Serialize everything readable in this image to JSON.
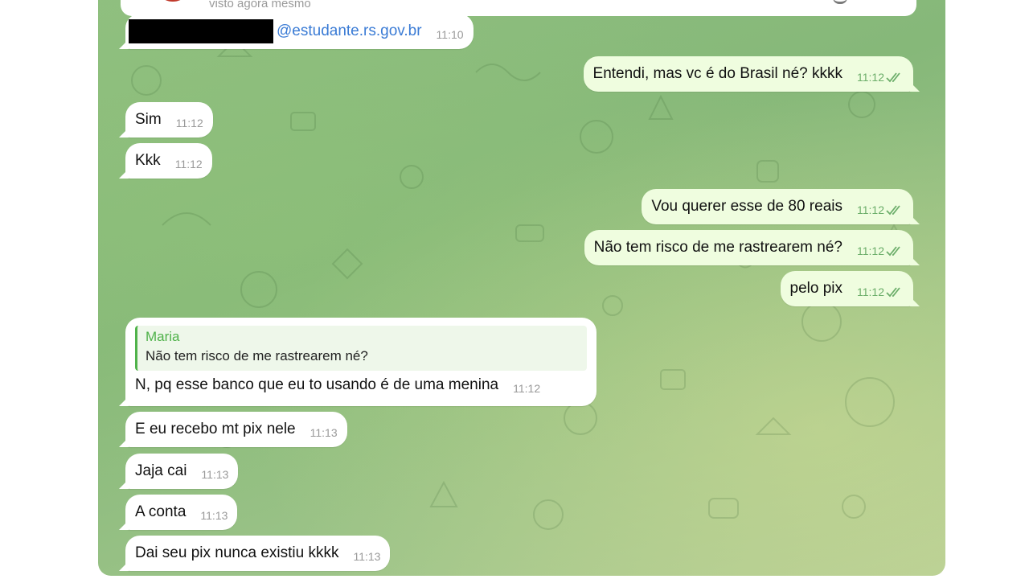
{
  "header": {
    "last_seen": "visto agora mesmo"
  },
  "messages": [
    {
      "side": "in",
      "email_domain": "@estudante.rs.gov.br",
      "time": "11:10",
      "email_redacted": true
    },
    {
      "side": "out",
      "text": "Entendi, mas vc é do Brasil né? kkkk",
      "time": "11:12",
      "read": true
    },
    {
      "side": "in",
      "text": "Sim",
      "time": "11:12"
    },
    {
      "side": "in",
      "text": "Kkk",
      "time": "11:12"
    },
    {
      "side": "out",
      "text": "Vou querer esse de 80 reais",
      "time": "11:12",
      "read": true
    },
    {
      "side": "out",
      "text": "Não tem risco de me rastrearem né?",
      "time": "11:12",
      "read": true
    },
    {
      "side": "out",
      "text": "pelo pix",
      "time": "11:12",
      "read": true
    },
    {
      "side": "in",
      "reply_to": {
        "name": "Maria",
        "text": "Não tem risco de me rastrearem né?"
      },
      "text": "N, pq esse banco que eu to usando é de uma menina",
      "time": "11:12"
    },
    {
      "side": "in",
      "text": "E eu recebo mt pix nele",
      "time": "11:13"
    },
    {
      "side": "in",
      "text": "Jaja cai",
      "time": "11:13"
    },
    {
      "side": "in",
      "text": "A conta",
      "time": "11:13"
    },
    {
      "side": "in",
      "text": "Dai seu pix nunca existiu kkkk",
      "time": "11:13"
    }
  ],
  "colors": {
    "incoming_bubble": "#ffffff",
    "outgoing_bubble": "#effddf",
    "read_ticks": "#6cae6a",
    "reply_accent": "#4fb24a",
    "link": "#3a7bd5"
  }
}
